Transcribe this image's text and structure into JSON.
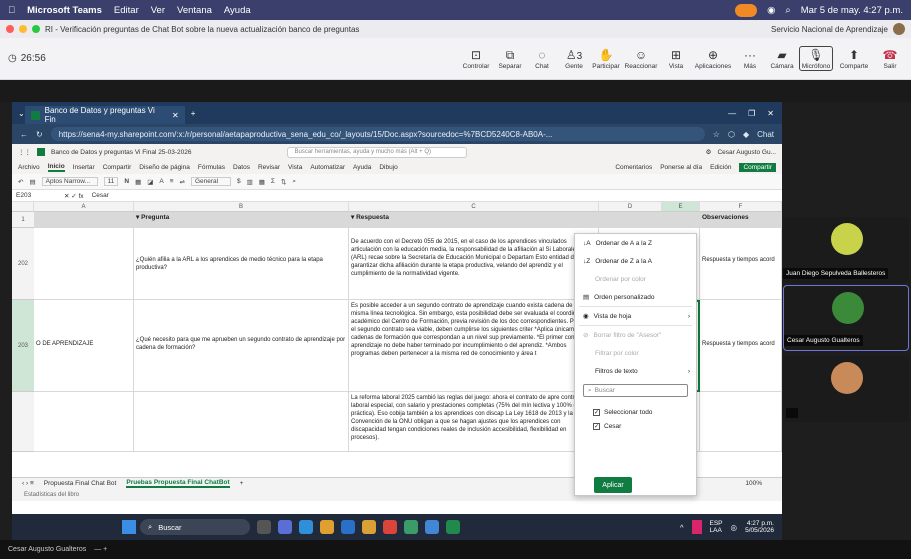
{
  "mac": {
    "apple": "",
    "app": "Microsoft Teams",
    "menus": [
      "Editar",
      "Ver",
      "Ventana",
      "Ayuda"
    ],
    "datetime": "Mar 5 de may.  4:27 p.m."
  },
  "teams": {
    "meeting_title": "RI - Verificación preguntas de Chat Bot sobre la nueva actualización banco de preguntas",
    "org": "Servicio Nacional de Aprendizaje",
    "timer": "26:56",
    "buttons": [
      "Controlar",
      "Separar",
      "Chat",
      "Gente",
      "Participar",
      "Reaccionar",
      "Vista",
      "Aplicaciones",
      "Más",
      "Cámara",
      "Micrófono",
      "Comparte",
      "Salir"
    ],
    "people_count": "3"
  },
  "edge": {
    "tab_title": "Banco de Datos y preguntas Vi Fin",
    "url": "https://sena4-my.sharepoint.com/:x:/r/personal/aetapaproductiva_sena_edu_co/_layouts/15/Doc.aspx?sourcedoc=%7BCD5240C8-AB0A-...",
    "chat_label": "Chat"
  },
  "excel": {
    "file_title": "Banco de Datos y preguntas Vi Final 25-03-2026",
    "search_placeholder": "Buscar herramientas, ayuda y mucho más (Alt + Q)",
    "user": "Cesar Augusto Gu...",
    "menus": [
      "Archivo",
      "Inicio",
      "Insertar",
      "Compartir",
      "Diseño de página",
      "Fórmulas",
      "Datos",
      "Revisar",
      "Vista",
      "Automatizar",
      "Ayuda",
      "Dibujo"
    ],
    "selected_menu": "Inicio",
    "ribbon_right": [
      "Comentarios",
      "Ponerse al día",
      "Edición",
      "Compartir"
    ],
    "font_name": "Aptos Narrow...",
    "font_size": "11",
    "format": "General",
    "cell_ref": "E203",
    "formula": "Cesar",
    "columns": [
      "A",
      "B",
      "C",
      "D",
      "E",
      "F"
    ],
    "header_row": {
      "num": "1",
      "pregunta": "Pregunta",
      "respuesta": "Respuesta",
      "observaciones": "Observaciones"
    },
    "rows": [
      {
        "num": "202",
        "a": "",
        "pregunta": "¿Quién afilia a la ARL a los aprendices de medio técnico para la etapa productiva?",
        "respuesta": "De acuerdo con el Decreto 055 de 2015, en el caso de los aprendices vinculados articulación con la educación media, la responsabilidad de la afiliación al Si Laborales (ARL) recae sobre la Secretaría de Educación Municipal o Departam Esto entidad debe garantizar dicha afiliación durante la etapa productiva, velando del aprendiz y el cumplimiento de la normatividad vigente.",
        "obs": "Respuesta y tiempos acord"
      },
      {
        "num": "203",
        "a": "O DE APRENDIZAJE",
        "pregunta": "¿Qué necesito para que me aprueben un segundo contrato de aprendizaje por cadena de formación?",
        "respuesta": "Es posible acceder a un segundo contrato de aprendizaje cuando exista cadena de de la misma línea tecnológica. Sin embargo, esta posibilidad debe ser evaluada el coordinador académico del Centro de Formación, previa revisión de los doc correspondientes. Para que el segundo contrato sea viable, deben cumplirse los siguientes criter *Aplica únicamente a cadenas de formación que correspondan a un nivel sup previamente. *El primer contrato de aprendizaje no debe haber terminado por incumplimiento o del aprendiz. *Ambos programas deben pertenecer a la misma red de conocimiento y área t",
        "obs": "Respuesta y tiempos acord"
      },
      {
        "num": "",
        "a": "",
        "pregunta": "",
        "respuesta": "La reforma laboral 2025 cambió las reglas del juego: ahora el contrato de apre contrato laboral especial, con salario y prestaciones completas (75% del mín lectiva y 100% en la práctica). Eso cobija también a los aprendices con discap La Ley 1618 de 2013 y la Convención de la ONU obligan a que se hagan ajustes que los aprendices con discapacidad tengan condiciones reales de inclusión accesibilidad, flexibilidad en procesos).",
        "obs": ""
      }
    ],
    "sheet_tabs": [
      "Propuesta Final Chat Bot",
      "Pruebas Propuesta Final ChatBot"
    ],
    "selected_sheet": "Pruebas Propuesta Final ChatBot",
    "status": "Estadísticas del libro",
    "zoom": "100%"
  },
  "filter_menu": {
    "sort_az": "Ordenar de A a la Z",
    "sort_za": "Ordenar de Z a la A",
    "sort_color": "Ordenar por color",
    "custom_order": "Orden personalizado",
    "sheet_view": "Vista de hoja",
    "clear_filter": "Borrar filtro de \"Asesor\"",
    "filter_color": "Filtrar por color",
    "text_filters": "Filtros de texto",
    "search_placeholder": "Buscar",
    "select_all": "Seleccionar todo",
    "value1": "Cesar",
    "apply": "Aplicar"
  },
  "participants": [
    {
      "name": "Juan Diego Sepulveda Ballesteros",
      "color": "#c8d24a"
    },
    {
      "name": "Cesar Augusto Gualteros",
      "color": "#3a8a3a"
    },
    {
      "name": "",
      "color": "#c98a5a"
    }
  ],
  "taskbar": {
    "search": "Buscar",
    "lang": "ESP",
    "lang2": "LAA",
    "time": "4:27 p.m.",
    "date": "5/05/2026"
  },
  "bottom": {
    "name": "Cesar Augusto Gualteros"
  }
}
